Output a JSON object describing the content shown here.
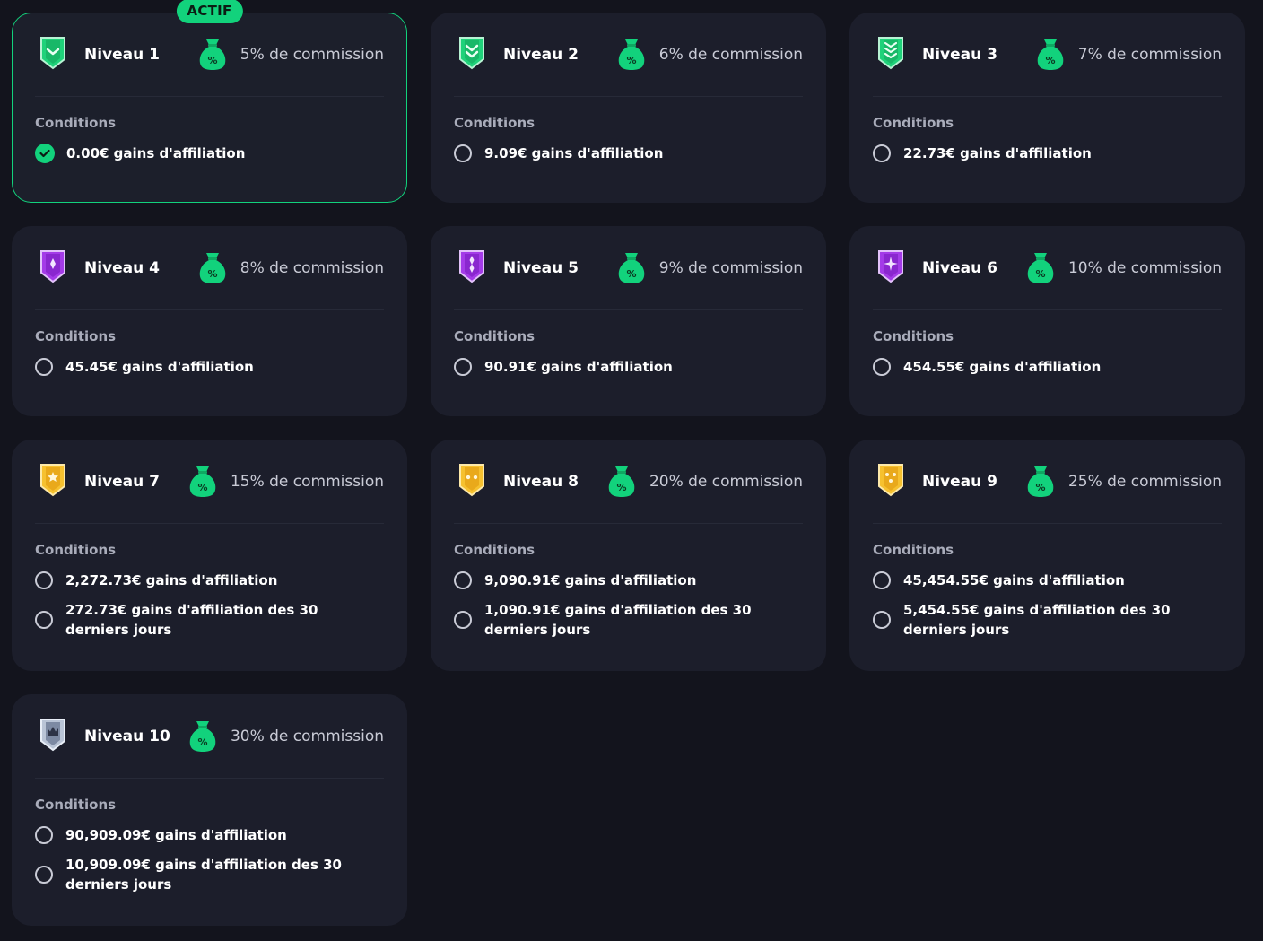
{
  "active_badge": "ACTIF",
  "conditions_label": "Conditions",
  "colors": {
    "background": "#13141d",
    "card": "#1c1e2b",
    "accent_green": "#12d27c"
  },
  "levels": [
    {
      "name": "Niveau 1",
      "commission": "5% de commission",
      "shield_icon": "green-shield-chevron-icon",
      "active": true,
      "conditions": [
        {
          "text": "0.00€ gains d'affiliation",
          "met": true
        }
      ]
    },
    {
      "name": "Niveau 2",
      "commission": "6% de commission",
      "shield_icon": "green-shield-double-chevron-icon",
      "active": false,
      "conditions": [
        {
          "text": "9.09€ gains d'affiliation",
          "met": false
        }
      ]
    },
    {
      "name": "Niveau 3",
      "commission": "7% de commission",
      "shield_icon": "green-shield-triple-chevron-icon",
      "active": false,
      "conditions": [
        {
          "text": "22.73€ gains d'affiliation",
          "met": false
        }
      ]
    },
    {
      "name": "Niveau 4",
      "commission": "8% de commission",
      "shield_icon": "purple-shield-diamond-icon",
      "active": false,
      "conditions": [
        {
          "text": "45.45€ gains d'affiliation",
          "met": false
        }
      ]
    },
    {
      "name": "Niveau 5",
      "commission": "9% de commission",
      "shield_icon": "purple-shield-double-diamond-icon",
      "active": false,
      "conditions": [
        {
          "text": "90.91€ gains d'affiliation",
          "met": false
        }
      ]
    },
    {
      "name": "Niveau 6",
      "commission": "10% de commission",
      "shield_icon": "purple-shield-cross-icon",
      "active": false,
      "conditions": [
        {
          "text": "454.55€ gains d'affiliation",
          "met": false
        }
      ]
    },
    {
      "name": "Niveau 7",
      "commission": "15% de commission",
      "shield_icon": "gold-shield-star-icon",
      "active": false,
      "conditions": [
        {
          "text": "2,272.73€ gains d'affiliation",
          "met": false
        },
        {
          "text": "272.73€ gains d'affiliation des 30 derniers jours",
          "met": false
        }
      ]
    },
    {
      "name": "Niveau 8",
      "commission": "20% de commission",
      "shield_icon": "gold-shield-double-star-icon",
      "active": false,
      "conditions": [
        {
          "text": "9,090.91€ gains d'affiliation",
          "met": false
        },
        {
          "text": "1,090.91€ gains d'affiliation des 30 derniers jours",
          "met": false
        }
      ]
    },
    {
      "name": "Niveau 9",
      "commission": "25% de commission",
      "shield_icon": "gold-shield-triple-star-icon",
      "active": false,
      "conditions": [
        {
          "text": "45,454.55€ gains d'affiliation",
          "met": false
        },
        {
          "text": "5,454.55€ gains d'affiliation des 30 derniers jours",
          "met": false
        }
      ]
    },
    {
      "name": "Niveau 10",
      "commission": "30% de commission",
      "shield_icon": "silver-shield-crown-icon",
      "active": false,
      "conditions": [
        {
          "text": "90,909.09€ gains d'affiliation",
          "met": false
        },
        {
          "text": "10,909.09€ gains d'affiliation des 30 derniers jours",
          "met": false
        }
      ]
    }
  ]
}
